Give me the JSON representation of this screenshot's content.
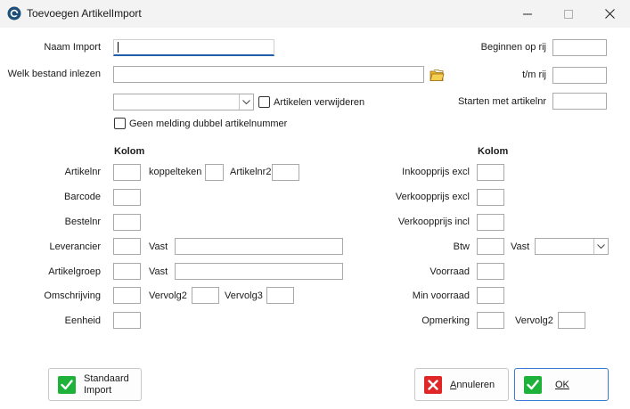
{
  "window": {
    "title": "Toevoegen ArtikelImport"
  },
  "top_form": {
    "naam_import_label": "Naam Import",
    "naam_import_value": "",
    "bestand_label": "Welk bestand inlezen",
    "bestand_value": "",
    "type_select_value": "",
    "artikelen_verwijderen_label": "Artikelen verwijderen",
    "artikelen_verwijderen_checked": false,
    "geen_melding_label": "Geen melding dubbel artikelnummer",
    "geen_melding_checked": false,
    "beginnen_label": "Beginnen op rij",
    "beginnen_value": "",
    "tm_rij_label": "t/m rij",
    "tm_rij_value": "",
    "starten_label": "Starten met artikelnr",
    "starten_value": ""
  },
  "left_columns": {
    "header": "Kolom",
    "artikelnr_label": "Artikelnr",
    "koppelteken_label": "koppelteken",
    "artikelnr2_label": "Artikelnr2",
    "barcode_label": "Barcode",
    "bestelnr_label": "Bestelnr",
    "leverancier_label": "Leverancier",
    "leverancier_vast_label": "Vast",
    "artikelgroep_label": "Artikelgroep",
    "artikelgroep_vast_label": "Vast",
    "omschrijving_label": "Omschrijving",
    "vervolg2_label": "Vervolg2",
    "vervolg3_label": "Vervolg3",
    "eenheid_label": "Eenheid"
  },
  "right_columns": {
    "header": "Kolom",
    "inkoopprijs_label": "Inkoopprijs excl",
    "verkoopprijs_excl_label": "Verkoopprijs excl",
    "verkoopprijs_incl_label": "Verkoopprijs incl",
    "btw_label": "Btw",
    "btw_vast_label": "Vast",
    "btw_vast_value": "",
    "voorraad_label": "Voorraad",
    "min_voorraad_label": "Min voorraad",
    "opmerking_label": "Opmerking",
    "opmerking_vervolg2_label": "Vervolg2"
  },
  "buttons": {
    "standaard_line1": "Standaard",
    "standaard_line2": "Import",
    "annuleren_first": "A",
    "annuleren_rest": "nnuleren",
    "ok_label": "OK"
  },
  "icons": {
    "app": "app-logo-icon",
    "minimize": "minimize-icon",
    "maximize": "maximize-icon",
    "close": "close-icon",
    "folder": "folder-icon",
    "check": "check-icon",
    "cancel": "x-icon"
  },
  "colors": {
    "accent": "#1f5fa8",
    "ok_green": "#1fb23a",
    "cancel_red": "#e02626",
    "default_button_border": "#3a7bd5"
  }
}
